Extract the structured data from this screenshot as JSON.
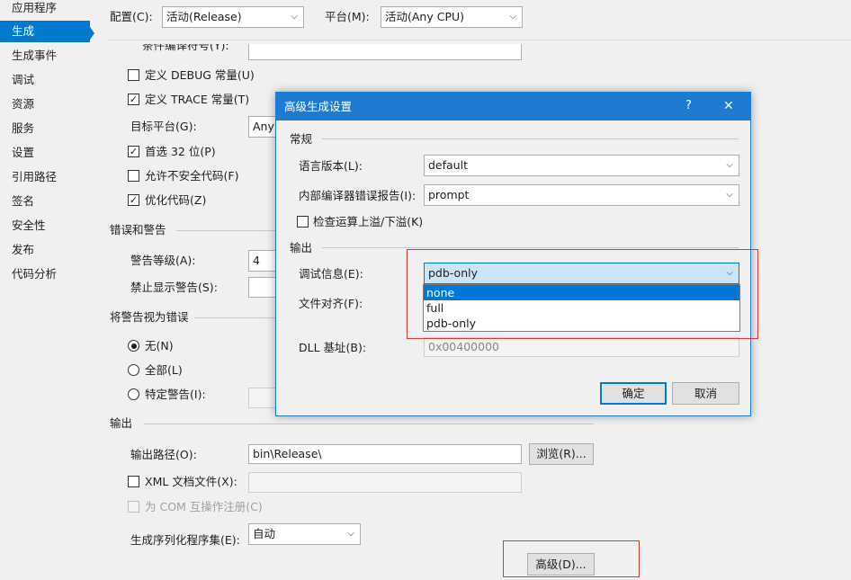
{
  "sidebar": {
    "items": [
      "应用程序",
      "生成",
      "生成事件",
      "调试",
      "资源",
      "服务",
      "设置",
      "引用路径",
      "签名",
      "安全性",
      "发布",
      "代码分析"
    ],
    "active_index": 1
  },
  "topbar": {
    "config_label": "配置(C):",
    "config_value": "活动(Release)",
    "platform_label": "平台(M):",
    "platform_value": "活动(Any CPU)"
  },
  "general": {
    "cond_symbols_label": "条件编译符号(Y):",
    "define_debug": "定义 DEBUG 常量(U)",
    "define_debug_checked": false,
    "define_trace": "定义 TRACE 常量(T)",
    "define_trace_checked": true,
    "target_platform_label": "目标平台(G):",
    "target_platform_value": "Any",
    "prefer32": "首选 32 位(P)",
    "prefer32_checked": true,
    "unsafe": "允许不安全代码(F)",
    "unsafe_checked": false,
    "optimize": "优化代码(Z)",
    "optimize_checked": true
  },
  "errors": {
    "section": "错误和警告",
    "warning_level_label": "警告等级(A):",
    "warning_level_value": "4",
    "suppress_label": "禁止显示警告(S):"
  },
  "treat_warnings": {
    "section": "将警告视为错误",
    "none": "无(N)",
    "all": "全部(L)",
    "specific": "特定警告(I):",
    "selected": "none"
  },
  "output": {
    "section": "输出",
    "path_label": "输出路径(O):",
    "path_value": "bin\\Release\\",
    "browse": "浏览(R)...",
    "xml_doc": "XML 文档文件(X):",
    "com_interop": "为 COM 互操作注册(C)",
    "serialization_label": "生成序列化程序集(E):",
    "serialization_value": "自动",
    "advanced_button": "高级(D)..."
  },
  "dialog": {
    "title": "高级生成设置",
    "help": "?",
    "close": "✕",
    "general_section": "常规",
    "lang_version_label": "语言版本(L):",
    "lang_version_value": "default",
    "error_report_label": "内部编译器错误报告(I):",
    "error_report_value": "prompt",
    "overflow_check": "检查运算上溢/下溢(K)",
    "overflow_checked": false,
    "output_section": "输出",
    "debug_info_label": "调试信息(E):",
    "debug_info_value": "pdb-only",
    "debug_info_options": [
      "none",
      "full",
      "pdb-only"
    ],
    "highlighted_option": "none",
    "file_align_label": "文件对齐(F):",
    "dll_base_label": "DLL 基址(B):",
    "dll_base_value": "0x00400000",
    "ok": "确定",
    "cancel": "取消"
  },
  "colors": {
    "accent": "#007acc",
    "dialog_title": "#1f7ad2",
    "highlight_box": "#e0362e",
    "selection": "#0078d7"
  }
}
